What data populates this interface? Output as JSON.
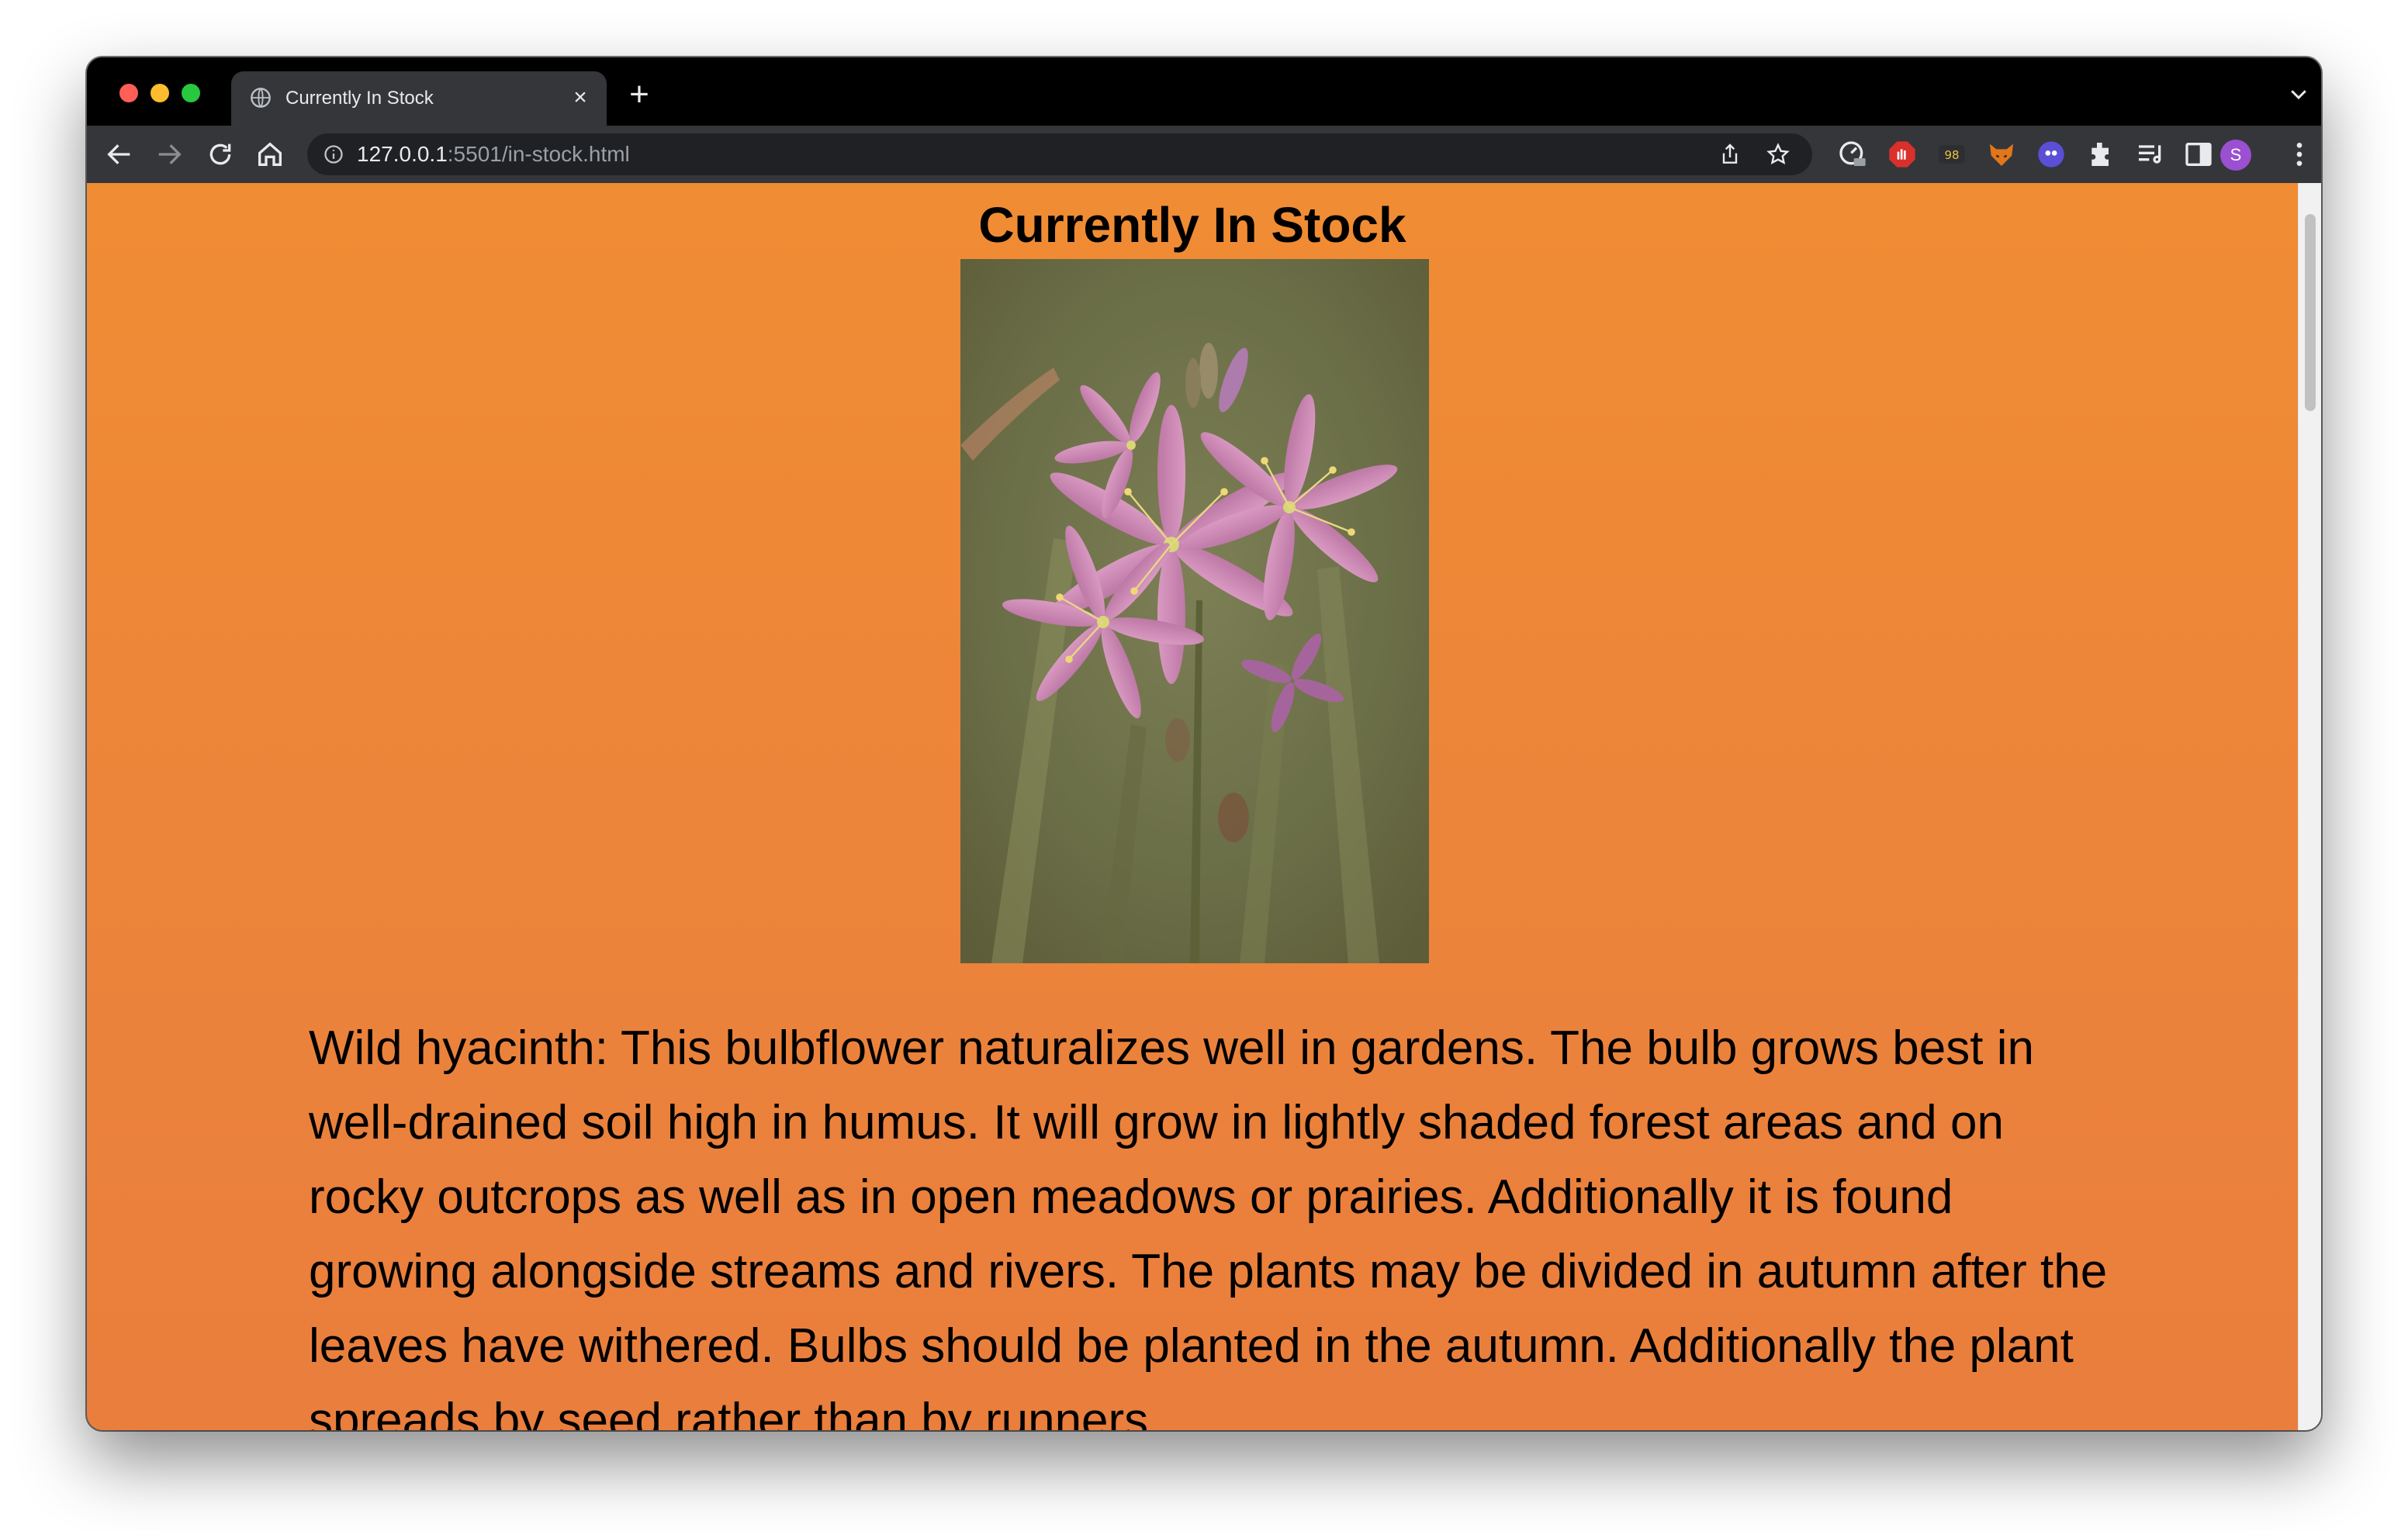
{
  "browser": {
    "tab_title": "Currently In Stock",
    "tab_close_glyph": "×",
    "new_tab_glyph": "+",
    "url_host": "127.0.0.1",
    "url_path": ":5501/in-stock.html",
    "profile_initial": "S",
    "icons": [
      "globe-icon",
      "back-arrow-icon",
      "forward-arrow-icon",
      "reload-icon",
      "home-icon",
      "info-icon",
      "share-icon",
      "star-icon",
      "extensions-icon",
      "reading-list-icon",
      "side-panel-icon",
      "more-menu-icon",
      "tab-search-icon"
    ]
  },
  "page": {
    "title": "Currently In Stock",
    "background_color": "#ee8a38",
    "description": "Wild hyacinth: This bulbflower naturalizes well in gardens. The bulb grows best in well-drained soil high in humus. It will grow in lightly shaded forest areas and on rocky outcrops as well as in open meadows or prairies. Additionally it is found growing alongside streams and rivers. The plants may be divided in autumn after the leaves have withered. Bulbs should be planted in the autumn. Additionally the plant spreads by seed rather than by runners."
  }
}
